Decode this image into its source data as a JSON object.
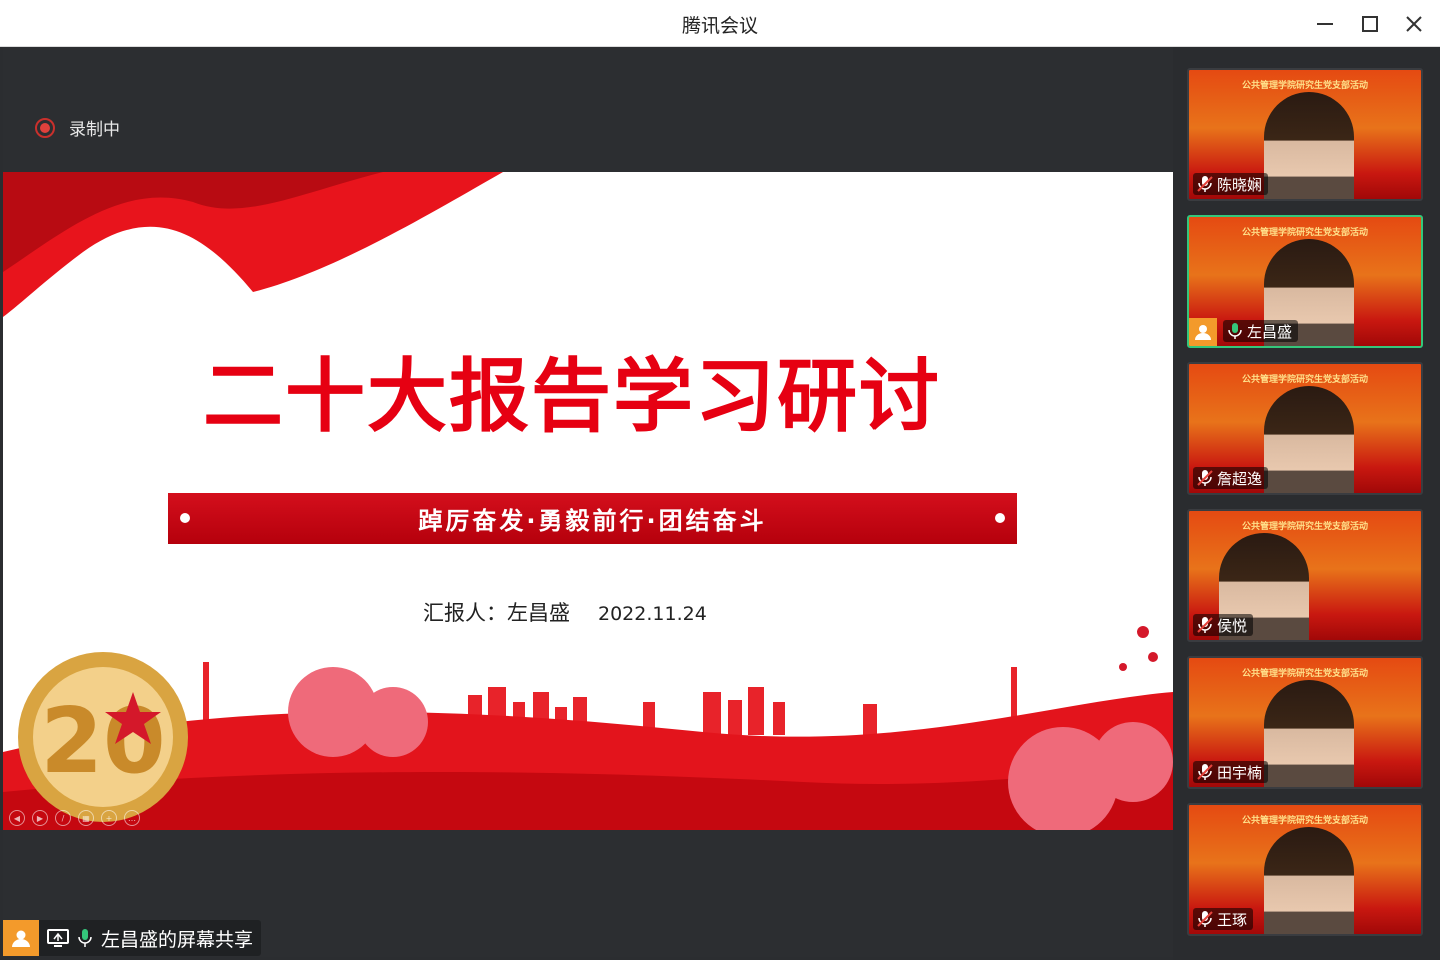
{
  "window": {
    "title": "腾讯会议"
  },
  "recording": {
    "label": "录制中"
  },
  "slide": {
    "title": "二十大报告学习研讨",
    "banner": "踔厉奋发·勇毅前行·团结奋斗",
    "presenter": "汇报人：左昌盛",
    "date": "2022.11.24"
  },
  "participants": [
    {
      "name": "陈晓娴",
      "muted": true,
      "active": false
    },
    {
      "name": "左昌盛",
      "muted": false,
      "active": true,
      "host": true
    },
    {
      "name": "詹超逸",
      "muted": true,
      "active": false
    },
    {
      "name": "侯悦",
      "muted": true,
      "active": false
    },
    {
      "name": "田宇楠",
      "muted": true,
      "active": false
    },
    {
      "name": "王琢",
      "muted": true,
      "active": false
    }
  ],
  "share": {
    "label": "左昌盛的屏幕共享"
  },
  "colors": {
    "accent_red": "#e60012",
    "mic_active": "#34c77b",
    "host_orange": "#f39a2b"
  }
}
